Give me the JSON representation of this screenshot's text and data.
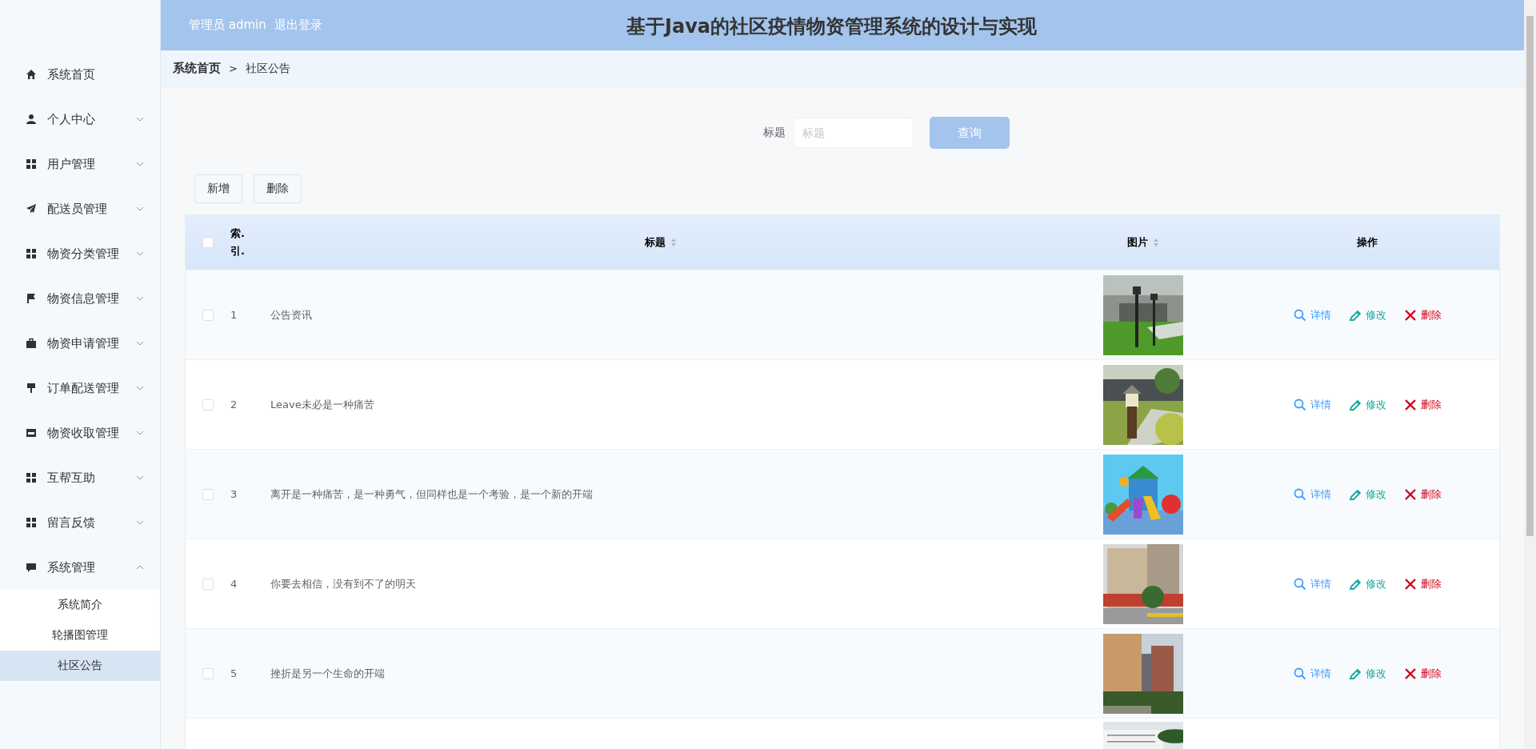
{
  "header": {
    "user_role": "管理员",
    "user_name": "admin",
    "logout": "退出登录",
    "title": "基于Java的社区疫情物资管理系统的设计与实现"
  },
  "sidebar": {
    "items": [
      {
        "label": "系统首页"
      },
      {
        "label": "个人中心",
        "expanded": false
      },
      {
        "label": "用户管理",
        "expanded": false
      },
      {
        "label": "配送员管理",
        "expanded": false
      },
      {
        "label": "物资分类管理",
        "expanded": false
      },
      {
        "label": "物资信息管理",
        "expanded": false
      },
      {
        "label": "物资申请管理",
        "expanded": false
      },
      {
        "label": "订单配送管理",
        "expanded": false
      },
      {
        "label": "物资收取管理",
        "expanded": false
      },
      {
        "label": "互帮互助",
        "expanded": false
      },
      {
        "label": "留言反馈",
        "expanded": false
      },
      {
        "label": "系统管理",
        "expanded": true,
        "children": [
          {
            "label": "系统简介",
            "selected": false
          },
          {
            "label": "轮播图管理",
            "selected": false
          },
          {
            "label": "社区公告",
            "selected": true
          }
        ]
      }
    ]
  },
  "breadcrumb": [
    "系统首页",
    ">",
    "社区公告"
  ],
  "search": {
    "label": "标题",
    "placeholder": "标题",
    "button": "查询"
  },
  "toolbar": [
    "新增",
    "删除"
  ],
  "table": {
    "header_checked": false,
    "columns": [
      {
        "label": "索.\n引.",
        "sortable": false
      },
      {
        "label": "标题",
        "sortable": true
      },
      {
        "label": "图片",
        "sortable": true
      },
      {
        "label": "操作",
        "sortable": false
      }
    ],
    "rows": [
      {
        "checked": false,
        "index": "1",
        "title": "公告资讯",
        "image": {
          "kind": "picture"
        },
        "actions": [
          {
            "kind": "detail",
            "label": "详情"
          },
          {
            "kind": "edit",
            "label": "修改"
          },
          {
            "kind": "delete",
            "label": "删除"
          }
        ]
      },
      {
        "checked": false,
        "index": "2",
        "title": "Leave未必是一种痛苦",
        "image": {
          "kind": "picture"
        },
        "actions": [
          {
            "kind": "detail",
            "label": "详情"
          },
          {
            "kind": "edit",
            "label": "修改"
          },
          {
            "kind": "delete",
            "label": "删除"
          }
        ]
      },
      {
        "checked": false,
        "index": "3",
        "title": "离开是一种痛苦，是一种勇气，但同样也是一个考验，是一个新的开端",
        "image": {
          "kind": "picture"
        },
        "actions": [
          {
            "kind": "detail",
            "label": "详情"
          },
          {
            "kind": "edit",
            "label": "修改"
          },
          {
            "kind": "delete",
            "label": "删除"
          }
        ]
      },
      {
        "checked": false,
        "index": "4",
        "title": "你要去相信，没有到不了的明天",
        "image": {
          "kind": "picture"
        },
        "actions": [
          {
            "kind": "detail",
            "label": "详情"
          },
          {
            "kind": "edit",
            "label": "修改"
          },
          {
            "kind": "delete",
            "label": "删除"
          }
        ]
      },
      {
        "checked": false,
        "index": "5",
        "title": "挫折是另一个生命的开端",
        "image": {
          "kind": "picture"
        },
        "actions": [
          {
            "kind": "detail",
            "label": "详情"
          },
          {
            "kind": "edit",
            "label": "修改"
          },
          {
            "kind": "delete",
            "label": "删除"
          }
        ]
      }
    ],
    "partial_row": {
      "image": {
        "kind": "picture"
      }
    }
  }
}
